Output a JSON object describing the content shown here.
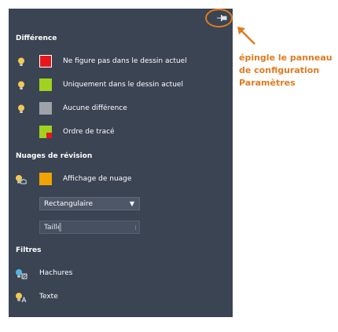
{
  "colors": {
    "accent": "#e07b1f",
    "panel_bg": "#3b4453",
    "red": "#e8161c",
    "green": "#a0d21f",
    "gray": "#9ea3aa",
    "orange": "#f0a400",
    "bulb": "#f2c955"
  },
  "panel": {
    "pin_icon": "pin-icon",
    "difference": {
      "title": "Différence",
      "items": [
        {
          "label": "Ne figure pas dans le dessin actuel",
          "swatch": "red-outlined"
        },
        {
          "label": "Uniquement dans le dessin actuel",
          "swatch": "green"
        },
        {
          "label": "Aucune différence",
          "swatch": "gray"
        },
        {
          "label": "Ordre de tracé",
          "swatch": "green-red"
        }
      ]
    },
    "clouds": {
      "title": "Nuages de révision",
      "display_label": "Affichage de nuage",
      "shape_value": "Rectangulaire",
      "size_label": "Taille"
    },
    "filters": {
      "title": "Filtres",
      "items": [
        {
          "label": "Hachures",
          "icon": "hatch-bulb-icon"
        },
        {
          "label": "Texte",
          "icon": "text-bulb-icon"
        }
      ]
    }
  },
  "callout": {
    "lines": [
      "épingle le panneau",
      "de configuration",
      "Paramètres"
    ]
  }
}
